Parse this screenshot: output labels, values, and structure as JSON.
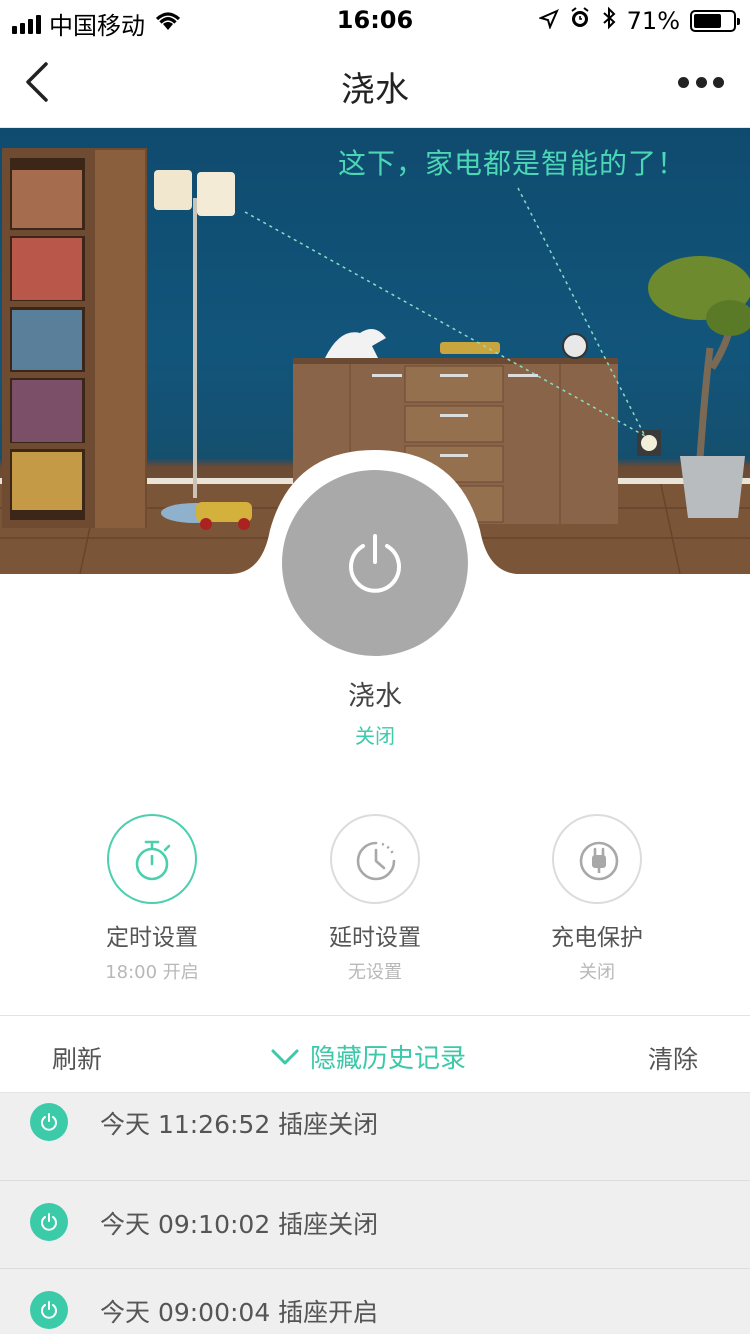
{
  "status_bar": {
    "carrier": "中国移动",
    "time": "16:06",
    "battery_percent": "71%",
    "battery_level": 0.71,
    "icons": [
      "signal-icon",
      "wifi-icon",
      "location-icon",
      "alarm-icon",
      "bluetooth-icon",
      "battery-icon"
    ]
  },
  "nav": {
    "title": "浇水",
    "back_icon": "chevron-left-icon",
    "more_icon": "more-dots-icon"
  },
  "hero": {
    "caption": "这下，家电都是智能的了！"
  },
  "device": {
    "name": "浇水",
    "state": "关闭",
    "power_icon": "power-icon"
  },
  "features": [
    {
      "label": "定时设置",
      "sub": "18:00 开启",
      "icon": "stopwatch-icon",
      "active": true
    },
    {
      "label": "延时设置",
      "sub": "无设置",
      "icon": "clock-icon",
      "active": false
    },
    {
      "label": "充电保护",
      "sub": "关闭",
      "icon": "plug-icon",
      "active": false
    }
  ],
  "actions": {
    "refresh": "刷新",
    "toggle_history": "隐藏历史记录",
    "clear": "清除"
  },
  "history": [
    {
      "text": "今天 11:26:52 插座关闭"
    },
    {
      "text": "今天 09:10:02 插座关闭"
    },
    {
      "text": "今天 09:00:04 插座开启"
    }
  ],
  "colors": {
    "accent": "#3ccba9",
    "power_button": "#a9a9aa",
    "wall": "#12557b"
  }
}
